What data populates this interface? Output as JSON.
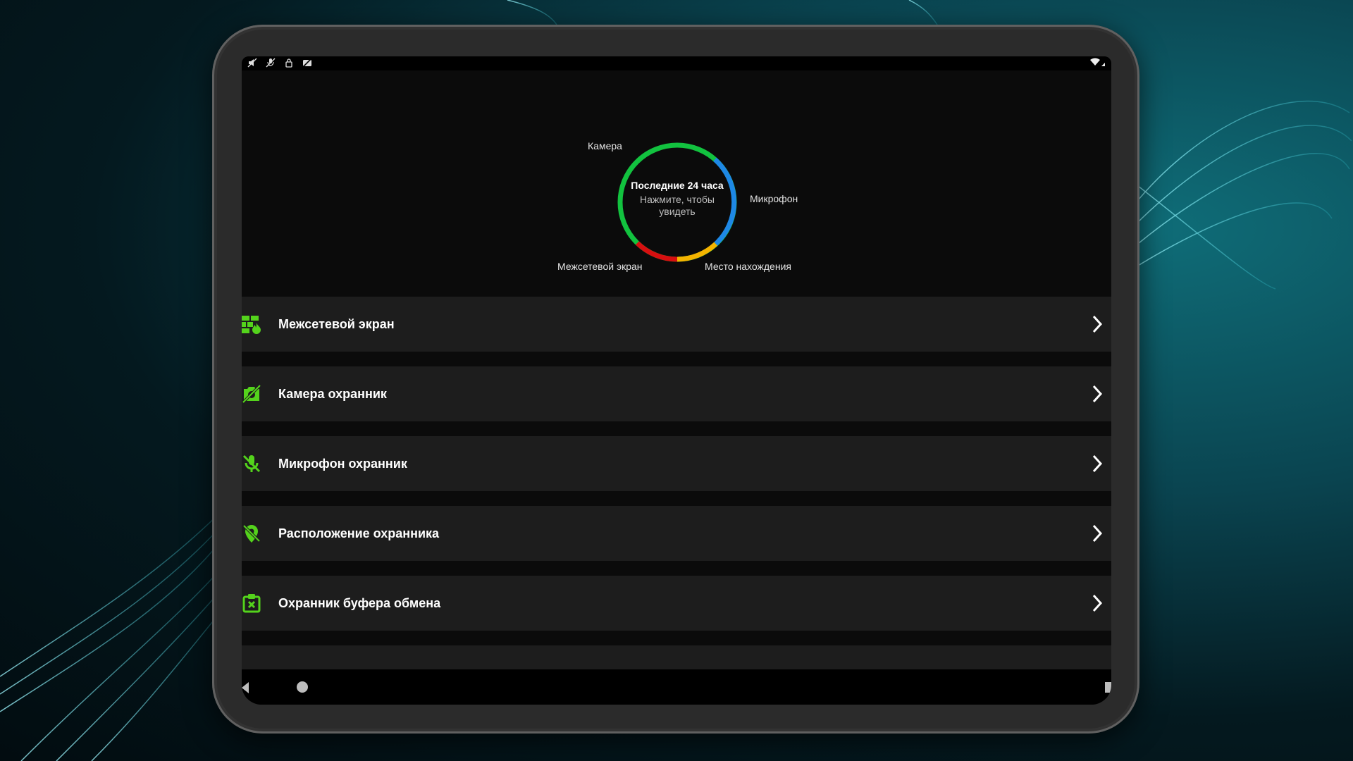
{
  "status_bar": {
    "icons": [
      "no-sound-icon",
      "mic-off-icon",
      "mic-lock-icon",
      "camera-off-icon"
    ],
    "right_icon": "wifi-icon"
  },
  "dashboard": {
    "title": "Последние 24 часа",
    "subtitle": "Нажмите, чтобы увидеть",
    "segments": [
      {
        "label": "Камера",
        "color": "#12c23f",
        "share": 0.58
      },
      {
        "label": "Микрофон",
        "color": "#1e88e5",
        "share": 0.17
      },
      {
        "label": "Место нахождения",
        "color": "#f4b400",
        "share": 0.12
      },
      {
        "label": "Межсетевой экран",
        "color": "#d60f10",
        "share": 0.13
      }
    ]
  },
  "accent_color": "#54d31c",
  "menu": [
    {
      "label": "Межсетевой экран",
      "icon": "firewall-icon"
    },
    {
      "label": "Камера охранник",
      "icon": "camera-off-icon"
    },
    {
      "label": "Микрофон охранник",
      "icon": "mic-off-icon"
    },
    {
      "label": "Расположение охранника",
      "icon": "location-off-icon"
    },
    {
      "label": "Охранник буфера обмена",
      "icon": "clipboard-x-icon"
    }
  ],
  "nav_bar": {
    "icons": [
      "back-icon",
      "home-icon",
      "recents-icon"
    ]
  }
}
